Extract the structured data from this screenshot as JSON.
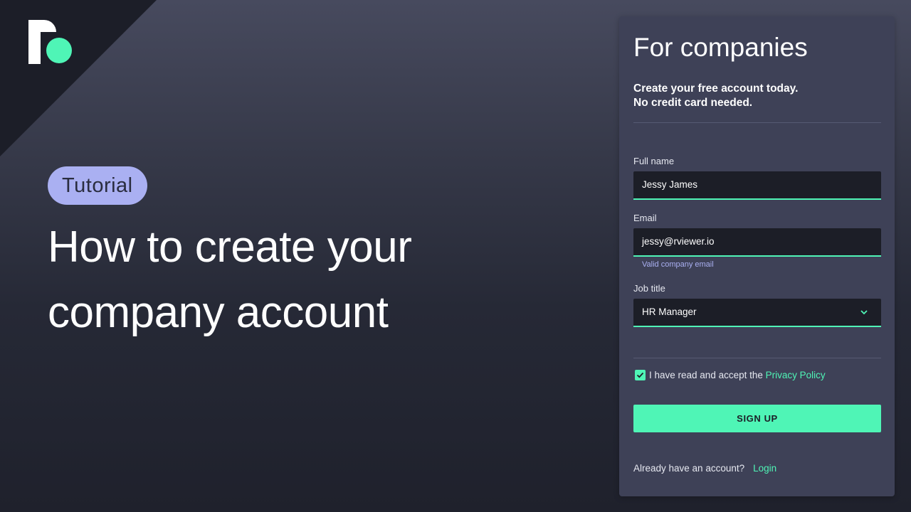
{
  "brand": {
    "accent_color": "#4ff5b6",
    "badge_color": "#aab0f2",
    "logo_icon": "rviewer-logo-icon"
  },
  "hero": {
    "badge": "Tutorial",
    "headline_line1": "How to create your",
    "headline_line2": "company account"
  },
  "form": {
    "title": "For companies",
    "subtitle_line1": "Create your free account today.",
    "subtitle_line2": "No credit card needed.",
    "full_name": {
      "label": "Full name",
      "value": "Jessy James"
    },
    "email": {
      "label": "Email",
      "value": "jessy@rviewer.io",
      "hint": "Valid company email"
    },
    "job_title": {
      "label": "Job title",
      "value": "HR Manager",
      "icon": "chevron-down-icon"
    },
    "consent": {
      "checked": true,
      "text": "I have read and accept the ",
      "link": "Privacy Policy"
    },
    "submit_label": "SIGN UP",
    "login_prompt": "Already have an account?",
    "login_link": "Login"
  }
}
